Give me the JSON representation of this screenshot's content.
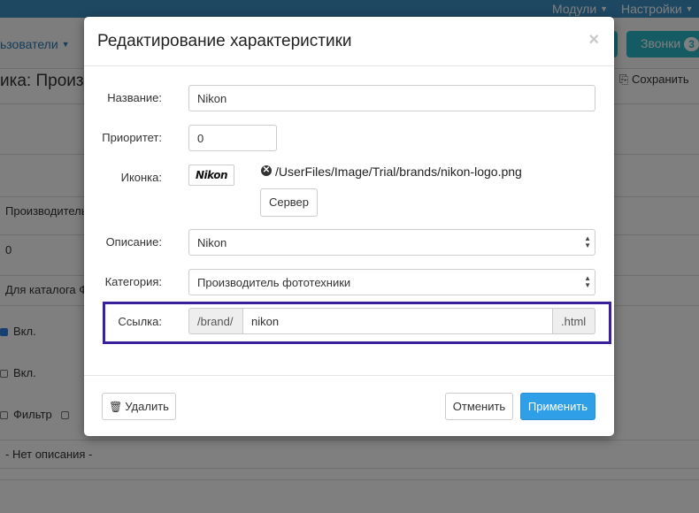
{
  "background": {
    "top_menu": [
      {
        "label": "Модули"
      },
      {
        "label": "Настройки"
      }
    ],
    "users_label": "ьзователи",
    "calls": {
      "label": "Звонки",
      "count": "3"
    },
    "page_title": "ика: Произв",
    "save_label": "Сохранить",
    "fields": {
      "manufacturer_text": "Производитель",
      "zero_text": "0",
      "catalog_text": "Для каталога Ф",
      "on_label_1": "Вкл.",
      "on_label_2": "Вкл.",
      "filter_label": "Фильтр",
      "no_description": "- Нет описания -"
    }
  },
  "modal": {
    "title": "Редактирование характеристики",
    "close_symbol": "×",
    "form": {
      "name": {
        "label": "Название:",
        "value": "Nikon"
      },
      "priority": {
        "label": "Приоритет:",
        "value": "0"
      },
      "icon": {
        "label": "Иконка:",
        "logo_text": "Nikon",
        "path": "/UserFiles/Image/Trial/brands/nikon-logo.png",
        "server_button": "Сервер"
      },
      "description": {
        "label": "Описание:",
        "value": "Nikon"
      },
      "category": {
        "label": "Категория:",
        "value": "Производитель фототехники"
      },
      "link": {
        "label": "Ссылка:",
        "prefix": "/brand/",
        "value": "nikon",
        "suffix": ".html"
      }
    },
    "footer": {
      "delete_label": "Удалить",
      "cancel_label": "Отменить",
      "apply_label": "Применить"
    }
  },
  "colors": {
    "accent": "#2f9fe8",
    "topbar": "#3d8ec4",
    "highlight_border": "#3a1f9e"
  }
}
